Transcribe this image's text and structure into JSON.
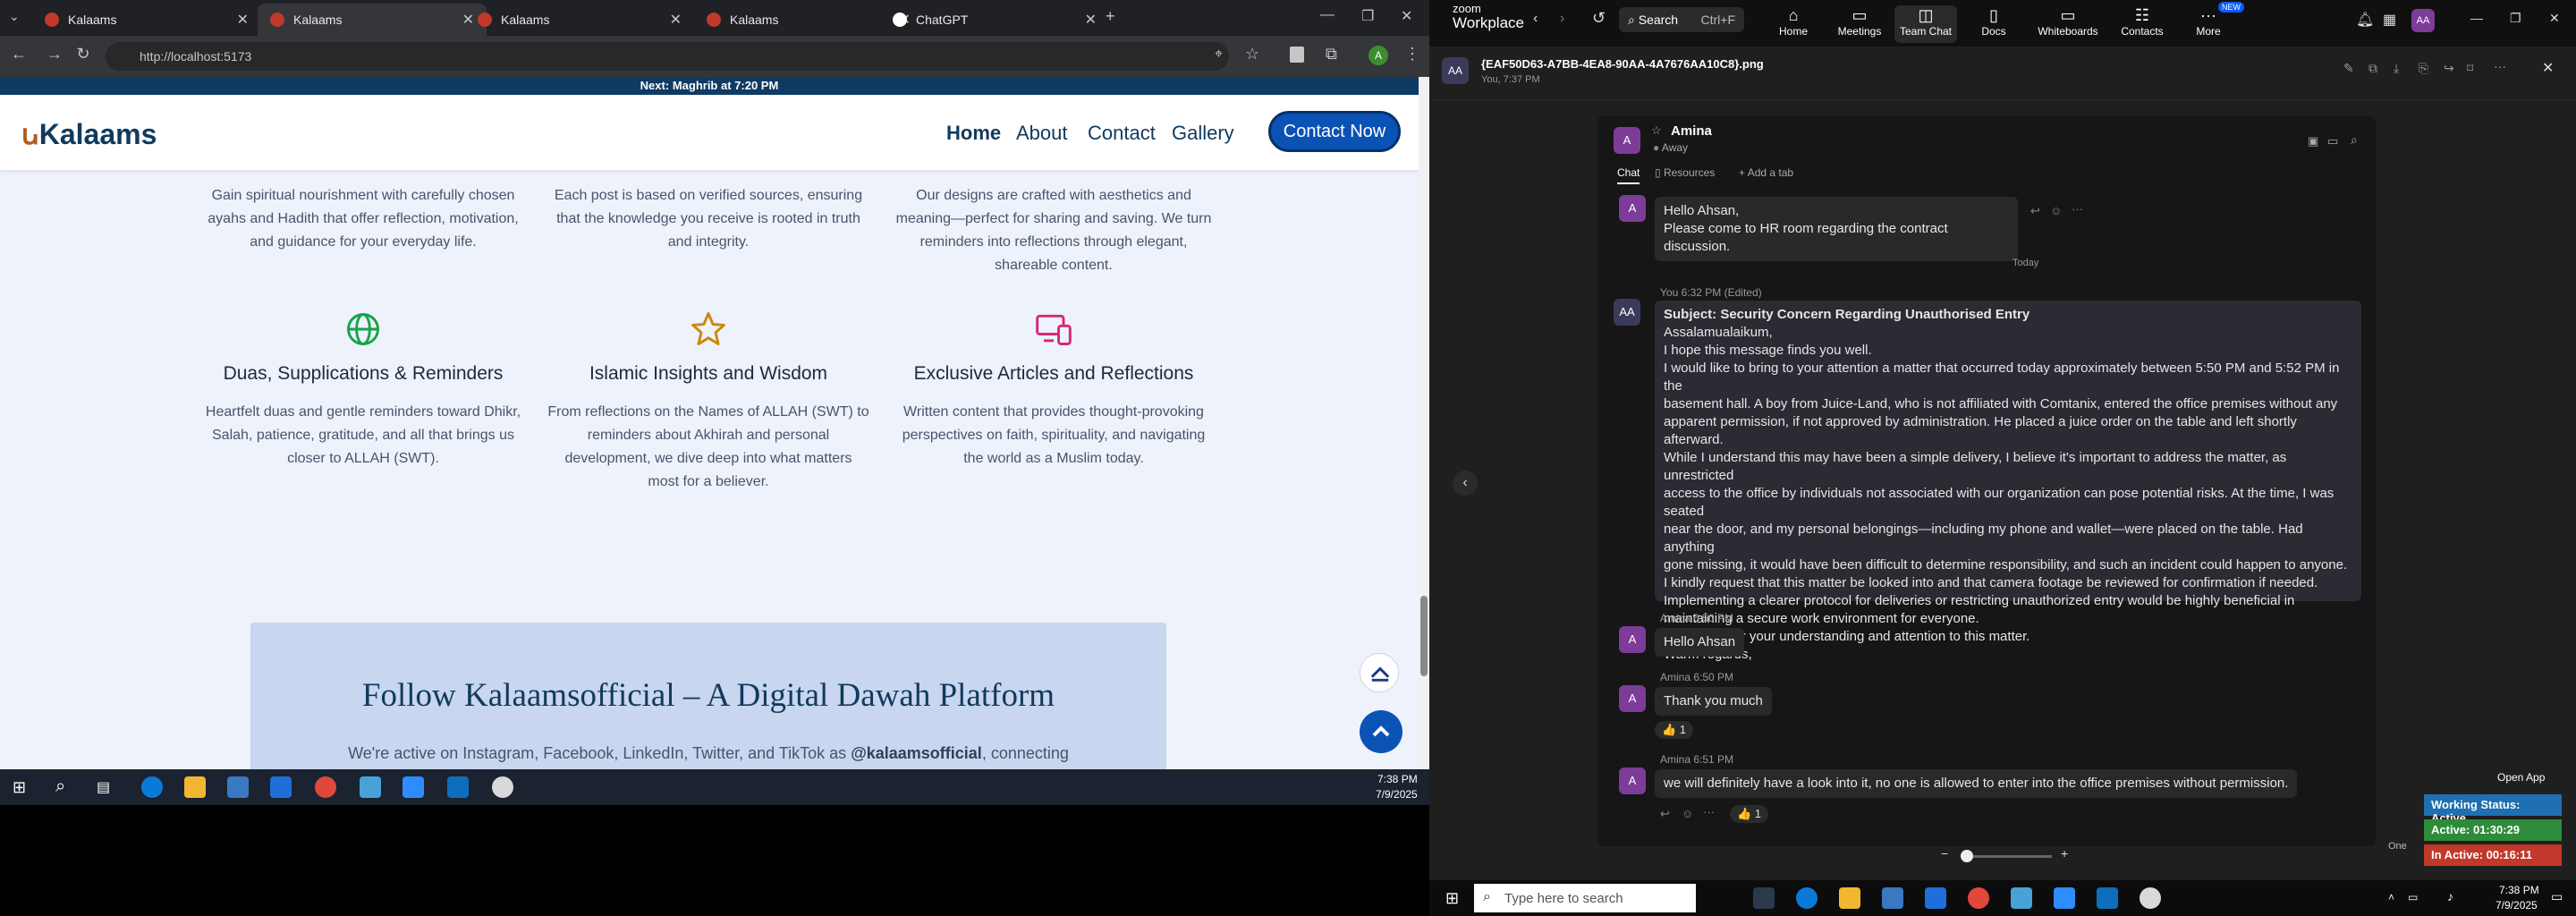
{
  "browser": {
    "tabs": [
      {
        "label": "Kalaams",
        "icon": "kalaams-favicon"
      },
      {
        "label": "Kalaams",
        "icon": "kalaams-favicon"
      },
      {
        "label": "Kalaams",
        "icon": "kalaams-favicon"
      },
      {
        "label": "Kalaams",
        "icon": "kalaams-favicon"
      },
      {
        "label": "ChatGPT",
        "icon": "chatgpt-favicon"
      }
    ],
    "url": "http://localhost:5173"
  },
  "site": {
    "banner_prefix": "Next:",
    "banner_prayer": "Maghrib",
    "banner_suffix": "at 7:20 PM",
    "logo": "Kalaams",
    "nav": {
      "home": "Home",
      "about": "About",
      "contact": "Contact",
      "gallery": "Gallery",
      "cta": "Contact Now"
    },
    "top_texts": [
      "Gain spiritual nourishment with carefully chosen ayahs and Hadith that offer reflection, motivation, and guidance for your everyday life.",
      "Each post is based on verified sources, ensuring that the knowledge you receive is rooted in truth and integrity.",
      "Our designs are crafted with aesthetics and meaning—perfect for sharing and saving. We turn reminders into reflections through elegant, shareable content."
    ],
    "features": [
      {
        "title": "Duas, Supplications & Reminders",
        "text": "Heartfelt duas and gentle reminders toward Dhikr, Salah, patience, gratitude, and all that brings us closer to ALLAH (SWT).",
        "icon": "globe-icon",
        "color": "#16a34a"
      },
      {
        "title": "Islamic Insights and Wisdom",
        "text": "From reflections on the Names of ALLAH (SWT) to reminders about Akhirah and personal development, we dive deep into what matters most for a believer.",
        "icon": "star-icon",
        "color": "#ca8a04"
      },
      {
        "title": "Exclusive Articles and Reflections",
        "text": "Written content that provides thought-provoking perspectives on faith, spirituality, and navigating the world as a Muslim today.",
        "icon": "devices-icon",
        "color": "#db2777"
      }
    ],
    "follow_title": "Follow Kalaamsofficial – A Digital Dawah Platform",
    "follow_text_prefix": "We're active on Instagram, Facebook, LinkedIn, Twitter, and TikTok as",
    "follow_handle": "@kalaamsofficial",
    "follow_text_suffix": ", connecting"
  },
  "taskbar_left": {
    "time": "7:38 PM",
    "date": "7/9/2025"
  },
  "zoom": {
    "brand_top": "zoom",
    "brand_bottom": "Workplace",
    "search": "Search",
    "search_shortcut": "Ctrl+F",
    "nav": [
      {
        "label": "Home",
        "icon": "home-icon"
      },
      {
        "label": "Meetings",
        "icon": "video-icon"
      },
      {
        "label": "Team Chat",
        "icon": "chat-icon"
      },
      {
        "label": "Docs",
        "icon": "doc-icon"
      },
      {
        "label": "Whiteboards",
        "icon": "whiteboard-icon"
      },
      {
        "label": "Contacts",
        "icon": "contacts-icon"
      },
      {
        "label": "More",
        "icon": "more-icon"
      }
    ],
    "new_badge": "NEW",
    "user_initials": "AA",
    "file_name": "{EAF50D63-A7BB-4EA8-90AA-4A7676AA10C8}.png",
    "file_meta": "You, 7:37 PM",
    "chat": {
      "contact": "Amina",
      "contact_initial": "A",
      "presence": "Away",
      "tabs": {
        "chat": "Chat",
        "resources": "Resources",
        "add": "Add a tab"
      },
      "msg1": {
        "lines": [
          "Hello Ahsan,",
          "Please come to HR room regarding the contract discussion."
        ]
      },
      "divider": "Today",
      "msg2": {
        "meta": "You 6:32 PM (Edited)",
        "subject": "Subject: Security Concern Regarding Unauthorised Entry",
        "lines": [
          "Assalamualaikum,",
          "I hope this message finds you well.",
          "I would like to bring to your attention a matter that occurred today approximately  between 5:50 PM and 5:52 PM in the",
          "basement hall. A boy from Juice-Land, who is not affiliated with Comtanix, entered the office premises without any",
          "apparent permission, if not approved by administration. He placed a juice order on the table and left shortly afterward.",
          "While I understand this may have been a simple delivery, I believe it's important to address the matter, as unrestricted",
          "access to the office by individuals not associated with our organization can pose potential risks. At the time, I was seated",
          "near the door, and my personal belongings—including my phone and wallet—were placed on the table. Had anything",
          "gone missing, it would have been difficult to determine responsibility, and such an incident could happen to anyone.",
          "I kindly request that this matter be looked into and that camera footage be reviewed for confirmation if needed.",
          "Implementing a clearer protocol for deliveries or restricting unauthorized entry would be highly beneficial in",
          "maintaining a secure work environment for everyone.",
          "Thank you for your understanding and attention to this matter.",
          "Warm regards,"
        ]
      },
      "msg3": {
        "meta": "Amina 6:50 PM",
        "text": "Hello Ahsan"
      },
      "msg4": {
        "meta": "Amina 6:50 PM",
        "text": "Thank you much",
        "reaction": "👍 1"
      },
      "msg5": {
        "meta": "Amina 6:51 PM",
        "text": "we will definitely have a look into it, no one is allowed to enter into the office premises without permission.",
        "reaction": "👍 1"
      }
    },
    "open_app": "Open App",
    "status": [
      {
        "label": "Working Status: Active",
        "color": "#1f6fb2"
      },
      {
        "label": "Active: 01:30:29",
        "color": "#2e8b3a"
      },
      {
        "label": "In Active: 00:16:11",
        "color": "#c0392b"
      }
    ],
    "one_label": "One"
  },
  "taskbar_right": {
    "search_placeholder": "Type here to search",
    "time": "7:38 PM",
    "date": "7/9/2025"
  }
}
